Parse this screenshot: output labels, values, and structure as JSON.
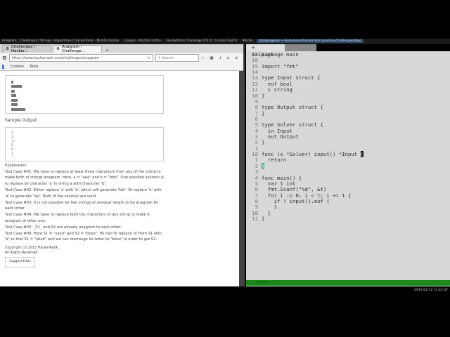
{
  "taskbar": {
    "items": [
      "Anagram : Challenges | Strings | Algorithms | HackerRank - Mozilla Firefox",
      "Google - Mozilla Firefox",
      "HackerRank Challenge [2][3] : Create File/Cd",
      "Mozilla"
    ],
    "active": "root@regenix:~/workspace/hackerrank.solutions/challenges/algo"
  },
  "browser": {
    "tabs": [
      "Challenges | Hacker...",
      "Anagram : Challenge..."
    ],
    "url": "https://www.hackerrank.com/challenges/anagram",
    "search_placeholder": "Search",
    "bookmarks": [
      "Context",
      "Tools"
    ],
    "sample_output_title": "Sample Output",
    "sample_output": [
      "3",
      "1",
      "-1",
      "2",
      "0",
      "1"
    ],
    "explanation_title": "Explanation",
    "explanation": [
      {
        "label": "Test Case #01:",
        "text": " We have to replace at least three characters from any of the string to make both of strings anagram. Here, a = \"aaa\" and b = \"bbb\". One possible solution is to replace all character 'a' in string a with character 'b'."
      },
      {
        "label": "Test Case #02:",
        "text": " Either replace 'a' with 'b', which will generate \"bb\". Or replace 'b' with 'a' to generate \"aa\". Both of the solution are valid."
      },
      {
        "label": "Test Case #03:",
        "text": " It is not possible for two strings of unequal length to be anagram for each other."
      },
      {
        "label": "Test Case #04:",
        "text": " We have to replace both the characters of any string to make it anagram of other one."
      },
      {
        "label": "Test Case #05:",
        "text": " _S1_ and S2 are already anagram to each other."
      },
      {
        "label": "Test Case #06:",
        "text": " Here S1 = \"xaxb\" and S2 = \"bbxx\". He had to replace 'a' from S1 with 'b' so that S1 = \"xbxb\" and we can rearrange its letter to \"bbxx\" in order to get S2."
      }
    ],
    "copyright": "Copyright (c) 2015 HackerRank.",
    "rights": "All Rights Reserved",
    "suggest_edits": "Suggest Edits"
  },
  "editor": {
    "tab": "+ main.go",
    "lines": [
      [
        "17",
        "package main"
      ],
      [
        "16",
        ""
      ],
      [
        "15",
        "import \"fmt\""
      ],
      [
        "14",
        ""
      ],
      [
        "13",
        "type Input struct {"
      ],
      [
        "12",
        "  eof bool"
      ],
      [
        "11",
        "  s string"
      ],
      [
        "10",
        "}"
      ],
      [
        "9",
        ""
      ],
      [
        "8",
        "type Output struct {"
      ],
      [
        "7",
        "}"
      ],
      [
        "6",
        ""
      ],
      [
        "5",
        "type Solver struct {"
      ],
      [
        "4",
        "  in Input"
      ],
      [
        "3",
        "  out Output"
      ],
      [
        "2",
        "}"
      ],
      [
        "1",
        ""
      ],
      [
        "18",
        "func (s *Solver) input() *Input "
      ],
      [
        "1",
        "  return"
      ],
      [
        "2",
        "}"
      ],
      [
        "3",
        ""
      ],
      [
        "4",
        "func main() {"
      ],
      [
        "5",
        "  var t int"
      ],
      [
        "6",
        "  fmt.Scanf(\"%d\", &t)"
      ],
      [
        "7",
        "  for i := 0; i < t; i += 1 {"
      ],
      [
        "8",
        "    if ! input().eof {"
      ],
      [
        "9",
        "    }"
      ],
      [
        "10",
        "  }"
      ],
      [
        "11",
        "}"
      ]
    ],
    "status": "-- INSERT --",
    "clock": "2015-02-12 11:41:47"
  },
  "colors": {
    "status_bar": "#1a8a1a",
    "editor_bg": "#d8d8d8"
  }
}
